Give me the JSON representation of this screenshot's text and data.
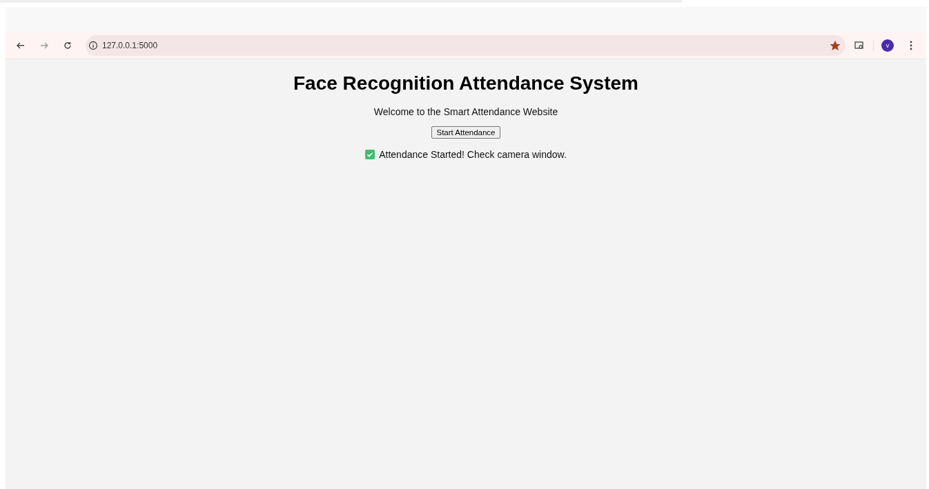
{
  "browser": {
    "url": "127.0.0.1:5000",
    "bookmarked": true,
    "profile_initial": "v"
  },
  "page": {
    "title": "Face Recognition Attendance System",
    "welcome": "Welcome to the Smart Attendance Website",
    "button": "Start Attendance",
    "status": {
      "kind": "success",
      "text": "Attendance Started! Check camera window."
    }
  }
}
